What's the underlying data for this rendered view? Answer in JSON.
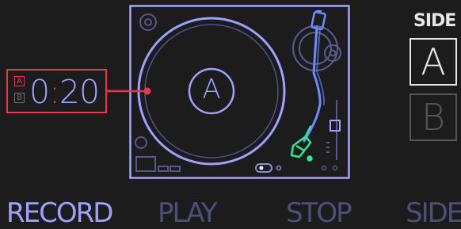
{
  "time_display": {
    "side_a": "A",
    "side_b": "B",
    "minutes": "0",
    "colon": ":",
    "seconds": "20"
  },
  "turntable": {
    "label": "A"
  },
  "side_selector": {
    "title": "SIDE",
    "options": [
      "A",
      "B"
    ],
    "selected": "A"
  },
  "controls": {
    "record": "RECORD",
    "play": "PLAY",
    "stop": "STOP",
    "side": "SIDE"
  },
  "colors": {
    "background": "#1c1c1c",
    "accent": "#e8374f",
    "turntable": "#9fa0ff",
    "tonearm": "#6a8cff",
    "headshell": "#2ee88a",
    "active_text": "#e6e6e6",
    "inactive": "#4e4e77"
  }
}
